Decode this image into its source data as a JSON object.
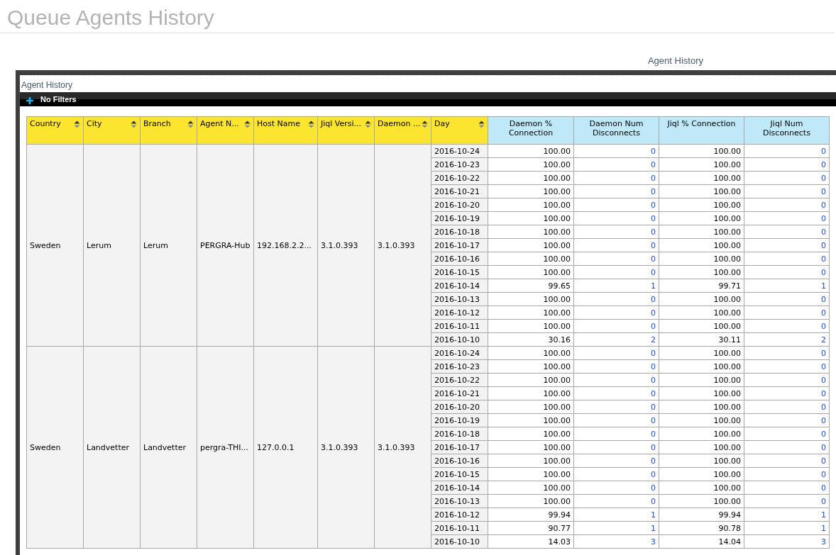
{
  "page_title": "Queue Agents History",
  "tab_label": "Agent History",
  "panel": {
    "title": "Agent History",
    "filter_label": "No Filters"
  },
  "table": {
    "columns": [
      {
        "label": "Country",
        "kind": "dimension"
      },
      {
        "label": "City",
        "kind": "dimension"
      },
      {
        "label": "Branch",
        "kind": "dimension"
      },
      {
        "label": "Agent N...",
        "kind": "dimension"
      },
      {
        "label": "Host Name",
        "kind": "dimension"
      },
      {
        "label": "Jiql Versi...",
        "kind": "dimension"
      },
      {
        "label": "Daemon ...",
        "kind": "dimension"
      },
      {
        "label": "Day",
        "kind": "dimension"
      },
      {
        "label": "Daemon % Connection",
        "kind": "measure"
      },
      {
        "label": "Daemon Num Disconnects",
        "kind": "measure"
      },
      {
        "label": "Jiql % Connection",
        "kind": "measure"
      },
      {
        "label": "Jiql Num Disconnects",
        "kind": "measure"
      }
    ],
    "groups": [
      {
        "country": "Sweden",
        "city": "Lerum",
        "branch": "Lerum",
        "agent": "PERGRA-Hub",
        "host": "192.168.2.2...",
        "jiql_version": "3.1.0.393",
        "daemon_version": "3.1.0.393",
        "rows": [
          [
            "2016-10-24",
            "100.00",
            "0",
            "100.00",
            "0"
          ],
          [
            "2016-10-23",
            "100.00",
            "0",
            "100.00",
            "0"
          ],
          [
            "2016-10-22",
            "100.00",
            "0",
            "100.00",
            "0"
          ],
          [
            "2016-10-21",
            "100.00",
            "0",
            "100.00",
            "0"
          ],
          [
            "2016-10-20",
            "100.00",
            "0",
            "100.00",
            "0"
          ],
          [
            "2016-10-19",
            "100.00",
            "0",
            "100.00",
            "0"
          ],
          [
            "2016-10-18",
            "100.00",
            "0",
            "100.00",
            "0"
          ],
          [
            "2016-10-17",
            "100.00",
            "0",
            "100.00",
            "0"
          ],
          [
            "2016-10-16",
            "100.00",
            "0",
            "100.00",
            "0"
          ],
          [
            "2016-10-15",
            "100.00",
            "0",
            "100.00",
            "0"
          ],
          [
            "2016-10-14",
            "99.65",
            "1",
            "99.71",
            "1"
          ],
          [
            "2016-10-13",
            "100.00",
            "0",
            "100.00",
            "0"
          ],
          [
            "2016-10-12",
            "100.00",
            "0",
            "100.00",
            "0"
          ],
          [
            "2016-10-11",
            "100.00",
            "0",
            "100.00",
            "0"
          ],
          [
            "2016-10-10",
            "30.16",
            "2",
            "30.11",
            "2"
          ]
        ]
      },
      {
        "country": "Sweden",
        "city": "Landvetter",
        "branch": "Landvetter",
        "agent": "pergra-THI...",
        "host": "127.0.0.1",
        "jiql_version": "3.1.0.393",
        "daemon_version": "3.1.0.393",
        "rows": [
          [
            "2016-10-24",
            "100.00",
            "0",
            "100.00",
            "0"
          ],
          [
            "2016-10-23",
            "100.00",
            "0",
            "100.00",
            "0"
          ],
          [
            "2016-10-22",
            "100.00",
            "0",
            "100.00",
            "0"
          ],
          [
            "2016-10-21",
            "100.00",
            "0",
            "100.00",
            "0"
          ],
          [
            "2016-10-20",
            "100.00",
            "0",
            "100.00",
            "0"
          ],
          [
            "2016-10-19",
            "100.00",
            "0",
            "100.00",
            "0"
          ],
          [
            "2016-10-18",
            "100.00",
            "0",
            "100.00",
            "0"
          ],
          [
            "2016-10-17",
            "100.00",
            "0",
            "100.00",
            "0"
          ],
          [
            "2016-10-16",
            "100.00",
            "0",
            "100.00",
            "0"
          ],
          [
            "2016-10-15",
            "100.00",
            "0",
            "100.00",
            "0"
          ],
          [
            "2016-10-14",
            "100.00",
            "0",
            "100.00",
            "0"
          ],
          [
            "2016-10-13",
            "100.00",
            "0",
            "100.00",
            "0"
          ],
          [
            "2016-10-12",
            "99.94",
            "1",
            "99.94",
            "1"
          ],
          [
            "2016-10-11",
            "90.77",
            "1",
            "90.78",
            "1"
          ],
          [
            "2016-10-10",
            "14.03",
            "3",
            "14.04",
            "3"
          ]
        ]
      }
    ]
  }
}
